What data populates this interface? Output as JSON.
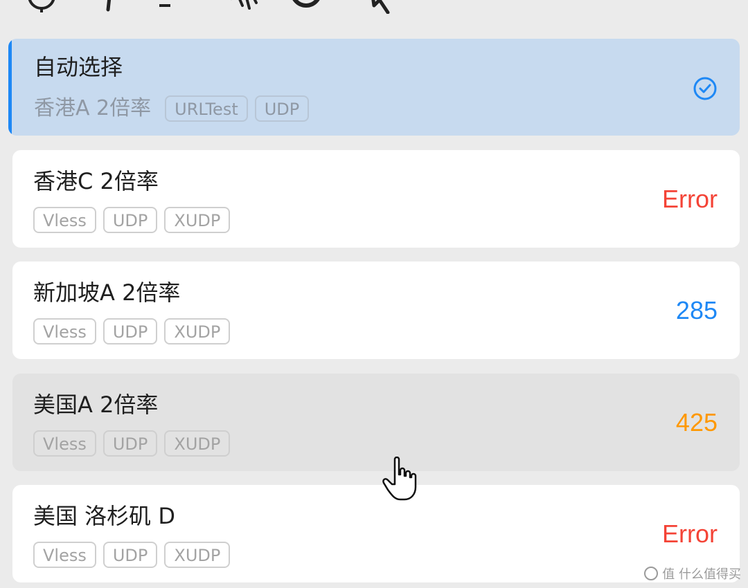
{
  "toolbar": {
    "icons": [
      "location-icon",
      "pin-icon",
      "minus-icon",
      "speedtest-icon",
      "refresh-icon",
      "pointer-icon"
    ]
  },
  "group": {
    "title": "自动选择",
    "current": "香港A 2倍率",
    "tags": [
      "URLTest",
      "UDP"
    ],
    "selected_icon": "check-circle-icon",
    "accent_color": "#1e88f5"
  },
  "nodes": [
    {
      "name": "香港C 2倍率",
      "tags": [
        "Vless",
        "UDP",
        "XUDP"
      ],
      "delay": "Error",
      "delay_color": "#f44336"
    },
    {
      "name": "新加坡A 2倍率",
      "tags": [
        "Vless",
        "UDP",
        "XUDP"
      ],
      "delay": "285",
      "delay_color": "#1e88f5"
    },
    {
      "name": "美国A 2倍率",
      "tags": [
        "Vless",
        "UDP",
        "XUDP"
      ],
      "delay": "425",
      "delay_color": "#ff9800"
    },
    {
      "name": "美国 洛杉矶 D",
      "tags": [
        "Vless",
        "UDP",
        "XUDP"
      ],
      "delay": "Error",
      "delay_color": "#f44336"
    }
  ],
  "watermark": "值 什么值得买"
}
